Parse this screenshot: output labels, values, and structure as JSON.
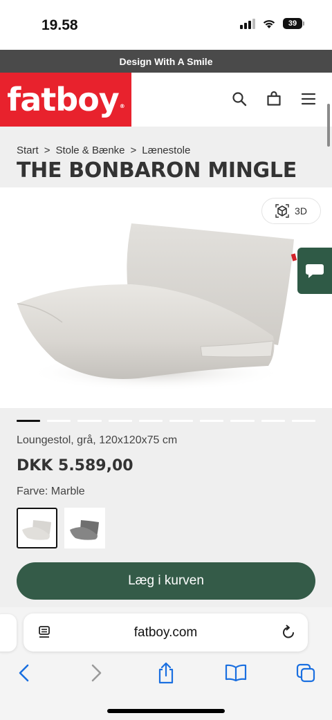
{
  "status_bar": {
    "time": "19.58",
    "battery_level": "39",
    "icons": [
      "signal-icon",
      "wifi-icon",
      "battery-icon"
    ]
  },
  "promo": {
    "text": "Design With A Smile"
  },
  "header": {
    "logo_text": "fatboy",
    "logo_mark": "®",
    "brand_color": "#e8222d",
    "icons": [
      "search-icon",
      "shopping-bag-icon",
      "menu-icon"
    ]
  },
  "breadcrumb": {
    "items": [
      "Start",
      "Stole & Bænke",
      "Lænestole"
    ],
    "separator": ">"
  },
  "product": {
    "title": "THE BONBARON MINGLE",
    "view_3d_label": "3D",
    "description": "Loungestol, grå, 120x120x75 cm",
    "price": "DKK 5.589,00",
    "color_label": "Farve: Marble",
    "swatches": [
      {
        "name": "Marble",
        "selected": true,
        "color": "#dcdad6"
      },
      {
        "name": "Grey",
        "selected": false,
        "color": "#7b7b7b"
      }
    ],
    "add_to_cart_label": "Læg i kurven",
    "accent_color": "#345b48"
  },
  "carousel": {
    "total": 10,
    "active_index": 0
  },
  "browser": {
    "url": "fatboy.com",
    "toolbar_icons": [
      "back-icon",
      "forward-icon",
      "share-icon",
      "bookmarks-icon",
      "tabs-icon"
    ]
  }
}
